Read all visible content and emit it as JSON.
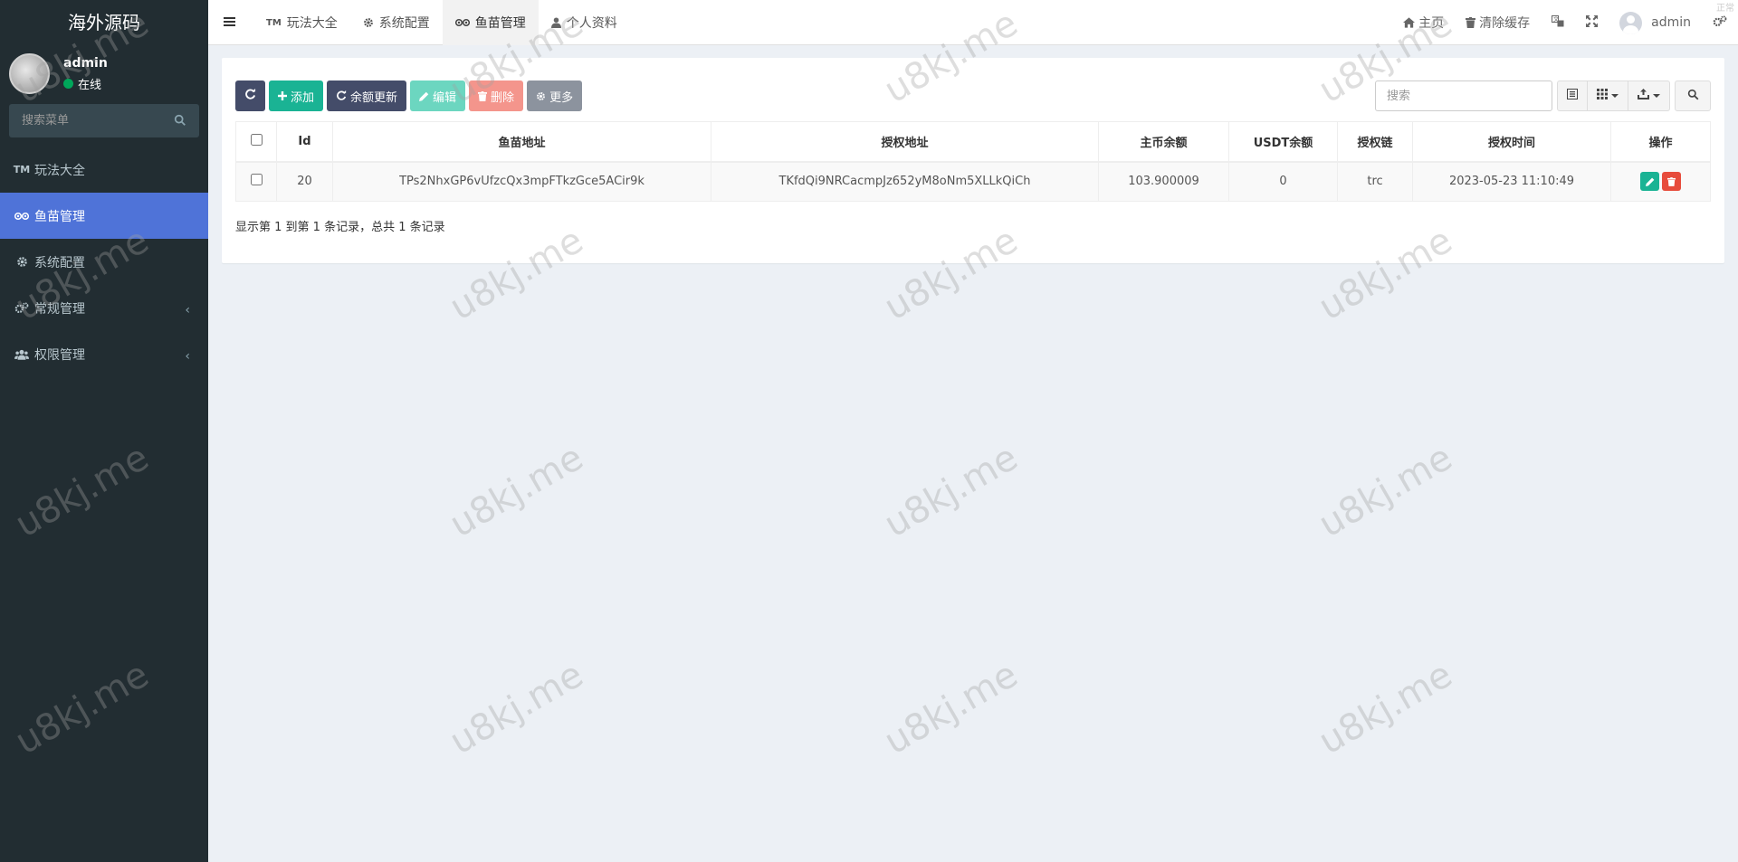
{
  "sidebar": {
    "logo": "海外源码",
    "user": {
      "name": "admin",
      "status": "在线"
    },
    "search_placeholder": "搜索菜单",
    "items": [
      {
        "label": "玩法大全",
        "icon": "tm-icon"
      },
      {
        "label": "鱼苗管理",
        "icon": "tripadvisor-icon"
      },
      {
        "label": "系统配置",
        "icon": "gear-icon"
      },
      {
        "label": "常规管理",
        "icon": "cogs-icon"
      },
      {
        "label": "权限管理",
        "icon": "users-icon"
      }
    ]
  },
  "header": {
    "tabs": [
      {
        "label": "玩法大全",
        "icon_text": "TM"
      },
      {
        "label": "系统配置"
      },
      {
        "label": "鱼苗管理"
      },
      {
        "label": "个人资料"
      }
    ],
    "home": "主页",
    "clear_cache": "清除缓存",
    "username": "admin",
    "corner": "正常"
  },
  "toolbar": {
    "add": "添加",
    "balance_update": "余额更新",
    "edit": "编辑",
    "delete": "删除",
    "more": "更多",
    "search_placeholder": "搜索"
  },
  "table": {
    "columns": [
      "Id",
      "鱼苗地址",
      "授权地址",
      "主币余额",
      "USDT余额",
      "授权链",
      "授权时间",
      "操作"
    ],
    "rows": [
      {
        "id": "20",
        "fish_address": "TPs2NhxGP6vUfzcQx3mpFTkzGce5ACir9k",
        "auth_address": "TKfdQi9NRCacmpJz652yM8oNm5XLLkQiCh",
        "main_balance": "103.900009",
        "usdt_balance": "0",
        "chain": "trc",
        "auth_time": "2023-05-23 11:10:49"
      }
    ]
  },
  "pager": "显示第 1 到第 1 条记录，总共 1 条记录",
  "watermark": "u8kj.me",
  "colors": {
    "sidebar_bg": "#222d32",
    "active_menu": "#4f73d8",
    "btn_dark": "#444c69",
    "btn_green": "#1ab394",
    "btn_delete": "#e74c3c"
  }
}
